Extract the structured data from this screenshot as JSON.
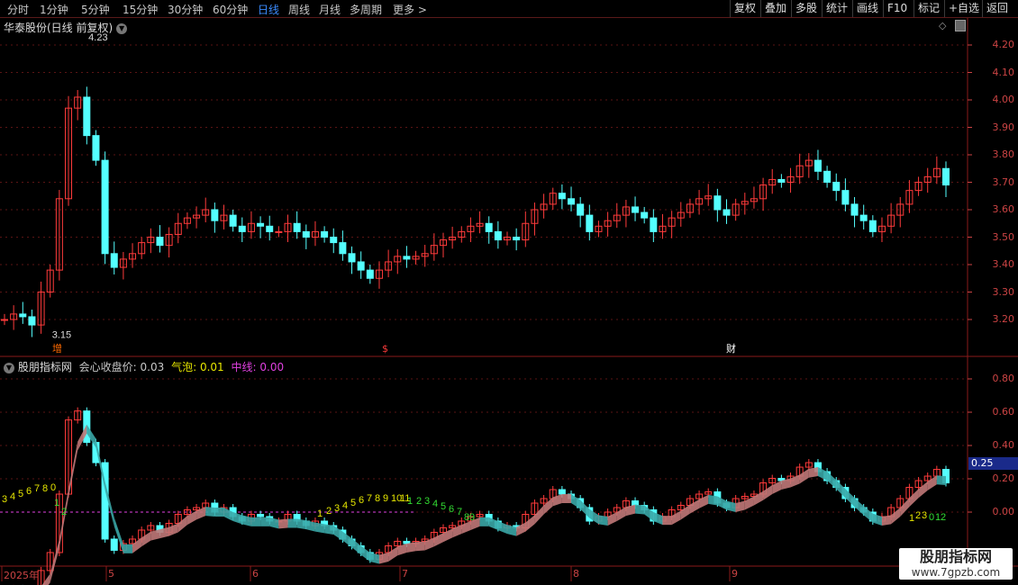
{
  "toolbar": {
    "periods": [
      "分时",
      "1分钟",
      "5分钟",
      "15分钟",
      "30分钟",
      "60分钟",
      "日线",
      "周线",
      "月线",
      "多周期",
      "更多 >"
    ],
    "active_index": 6,
    "right_buttons": [
      "复权",
      "叠加",
      "多股",
      "统计",
      "画线",
      "F10",
      "标记",
      "+自选",
      "返回"
    ]
  },
  "main_panel": {
    "title": "华泰股份(日线 前复权)",
    "y_ticks": [
      "4.20",
      "4.10",
      "4.00",
      "3.90",
      "3.80",
      "3.70",
      "3.60",
      "3.50",
      "3.40",
      "3.30",
      "3.20"
    ],
    "high_label": "4.23",
    "low_label": "3.15",
    "markers": [
      "增",
      "$",
      "财"
    ],
    "up_color": "#ff3b3b",
    "down_color": "#54ffff"
  },
  "sub_panel": {
    "title": "股朋指标网",
    "legend": [
      {
        "label": "会心收盘价:",
        "value": "0.03",
        "color": "#c8c8c8"
      },
      {
        "label": "气泡:",
        "value": "0.01",
        "color": "#e6e600"
      },
      {
        "label": "中线:",
        "value": "0.00",
        "color": "#e040e0"
      }
    ],
    "y_ticks": [
      "0.80",
      "0.60",
      "0.40",
      "0.20",
      "0.00"
    ],
    "current_value": "0.25",
    "seq_labels": [
      "3",
      "4",
      "5",
      "6",
      "7",
      "8",
      "0",
      "1",
      "2",
      "1",
      "2",
      "3",
      "4",
      "5",
      "6",
      "7",
      "8",
      "9",
      "10",
      "11",
      "1",
      "2",
      "3",
      "4",
      "5",
      "6",
      "7",
      "8",
      "9",
      "1",
      "2",
      "3",
      "0",
      "1",
      "2"
    ]
  },
  "x_axis": {
    "labels": [
      "2025年",
      "5",
      "6",
      "7",
      "8",
      "9"
    ]
  },
  "watermark": {
    "line1": "股朋指标网",
    "line2": "www.7gpzb.com"
  }
}
